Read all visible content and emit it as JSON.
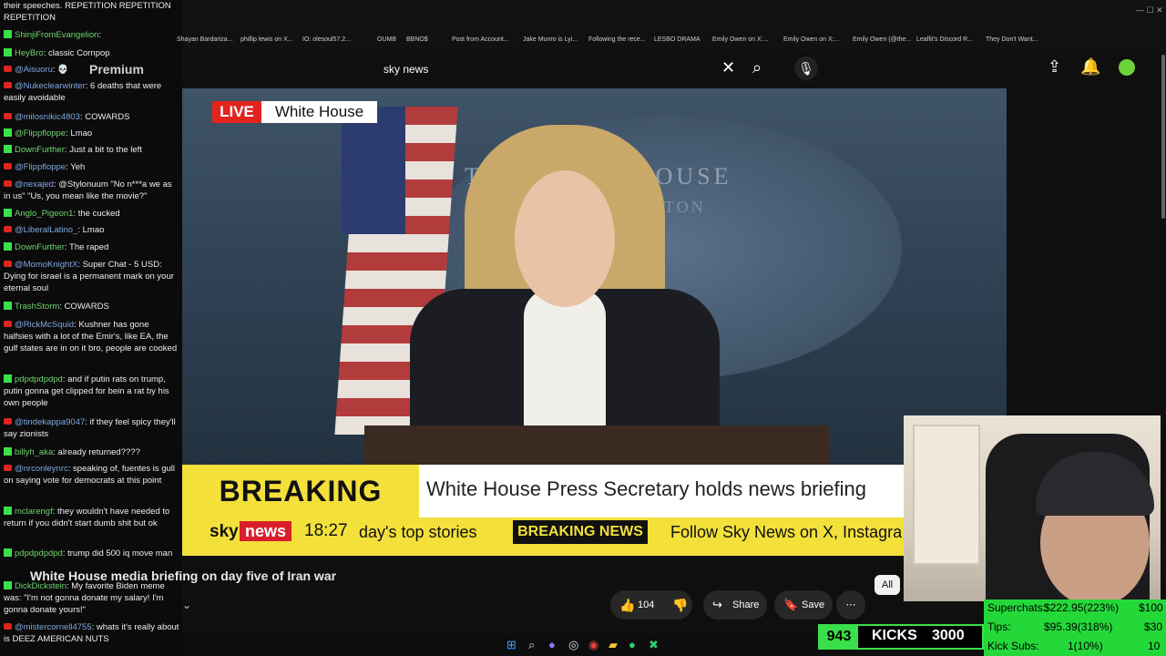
{
  "chat": {
    "lines": [
      {
        "src": "none",
        "user": "",
        "msg": "their speeches. REPETITION REPETITION REPETITION"
      },
      {
        "src": "k",
        "user": "ShinjiFromEvangelion",
        "msg": ""
      },
      {
        "src": "k",
        "user": "HeyBro",
        "msg": "classic Cornpop"
      },
      {
        "src": "y",
        "user": "@Aisuoru",
        "msg": "💀"
      },
      {
        "src": "y",
        "user": "@Nukeclearwinter",
        "msg": "6 deaths that were easily avoidable"
      },
      {
        "src": "y",
        "user": "@milosnikic4803",
        "msg": "COWARDS"
      },
      {
        "src": "k",
        "user": "@Flippfloppe",
        "msg": "Lmao"
      },
      {
        "src": "k",
        "user": "DownFurther",
        "msg": "Just a bit to the left"
      },
      {
        "src": "y",
        "user": "@Flippfloppe",
        "msg": "Yeh"
      },
      {
        "src": "y",
        "user": "@nexajed",
        "msg": "@Stylonuum \"No n***a we as in us\" \"Us, you mean like the movie?\""
      },
      {
        "src": "k",
        "user": "Anglo_Pigeon1",
        "msg": "the cucked"
      },
      {
        "src": "y",
        "user": "@LiberalLatino_",
        "msg": "Lmao"
      },
      {
        "src": "k",
        "user": "DownFurther",
        "msg": "The raped"
      },
      {
        "src": "y",
        "user": "@MomoKnightX",
        "msg": "Super Chat - 5 USD: Dying for israel is a permanent mark on your eternal soul"
      },
      {
        "src": "k",
        "user": "TrashStorm",
        "msg": "COWARDS"
      },
      {
        "src": "y",
        "user": "@RickMcSquid",
        "msg": "Kushner has gone halfsies with a lot of the Emir's, like EA, the gulf states are in on it bro, people are cooked"
      },
      {
        "src": "k",
        "user": "pdpdpdpdpd",
        "msg": "and if putin rats on trump, putin gonna get clipped for bein a rat by his own people"
      },
      {
        "src": "y",
        "user": "@tindekappa9047",
        "msg": "if they feel spicy they'll say zionists"
      },
      {
        "src": "k",
        "user": "billyh_aka",
        "msg": "already returned????"
      },
      {
        "src": "y",
        "user": "@nrconleynrc",
        "msg": "speaking of, fuentes is gull on saying vote for democrats at this point"
      },
      {
        "src": "k",
        "user": "mclarengf",
        "msg": "they wouldn't have needed to return if you didn't start dumb shit but ok"
      },
      {
        "src": "k",
        "user": "pdpdpdpdpd",
        "msg": "trump did 500 iq move man"
      },
      {
        "src": "k",
        "user": "DickDickstein",
        "msg": "My favorite Biden meme was: \"I'm not gonna donate my salary! I'm gonna donate yours!\""
      },
      {
        "src": "y",
        "user": "@mistercornell4755",
        "msg": "whats it's really about is DEEZ AMERICAN NUTS"
      }
    ]
  },
  "premium_label": "Premium",
  "bookmarks": [
    "Shayan Bardariza...",
    "phillip lewis on X...",
    "IO: olesoul57.2...",
    "OUMB",
    "BBNO$",
    "Post from Account...",
    "Jake Munro is Lyi...",
    "Following the rece...",
    "LESBO DRAMA",
    "Emily Owen on X:...",
    "Emily Owen on X:...",
    "Emily Owen (@the...",
    "Leaflit's Discord R...",
    "They Don't Want..."
  ],
  "search": {
    "query": "sky news"
  },
  "video": {
    "live_label": "LIVE",
    "live_location": "White House",
    "seal_text": "THE WHITE HOUSE",
    "seal_text2": "WASHINGTON",
    "breaking_label": "BREAKING NEWS",
    "headline": "White House Press Secretary holds news briefing",
    "sky_label": "sky",
    "news_label": "news",
    "time": "18:27",
    "ticker_1": "day's top stories",
    "ticker_breaking": "BREAKING NEWS",
    "ticker_2": "Follow Sky News on X, Instagra"
  },
  "video_title": "White House media briefing on day five of Iran war",
  "actions": {
    "likes": "104",
    "share": "Share",
    "save": "Save",
    "more": "⋯",
    "chip_all": "All"
  },
  "kicks": {
    "count": "943",
    "label": "KICKS",
    "goal": "3000"
  },
  "stats": {
    "superchats_label": "Superchats:",
    "superchats_value": "$222.95(223%)",
    "superchats_goal": "$100",
    "tips_label": "Tips:",
    "tips_value": "$95.39(318%)",
    "tips_goal": "$30",
    "kicksubs_label": "Kick Subs:",
    "kicksubs_value": "1(10%)",
    "kicksubs_goal": "10"
  },
  "colors": {
    "accent_red": "#e2241f",
    "kick_green": "#3ae04a",
    "sky_yellow": "#f3e03a"
  }
}
